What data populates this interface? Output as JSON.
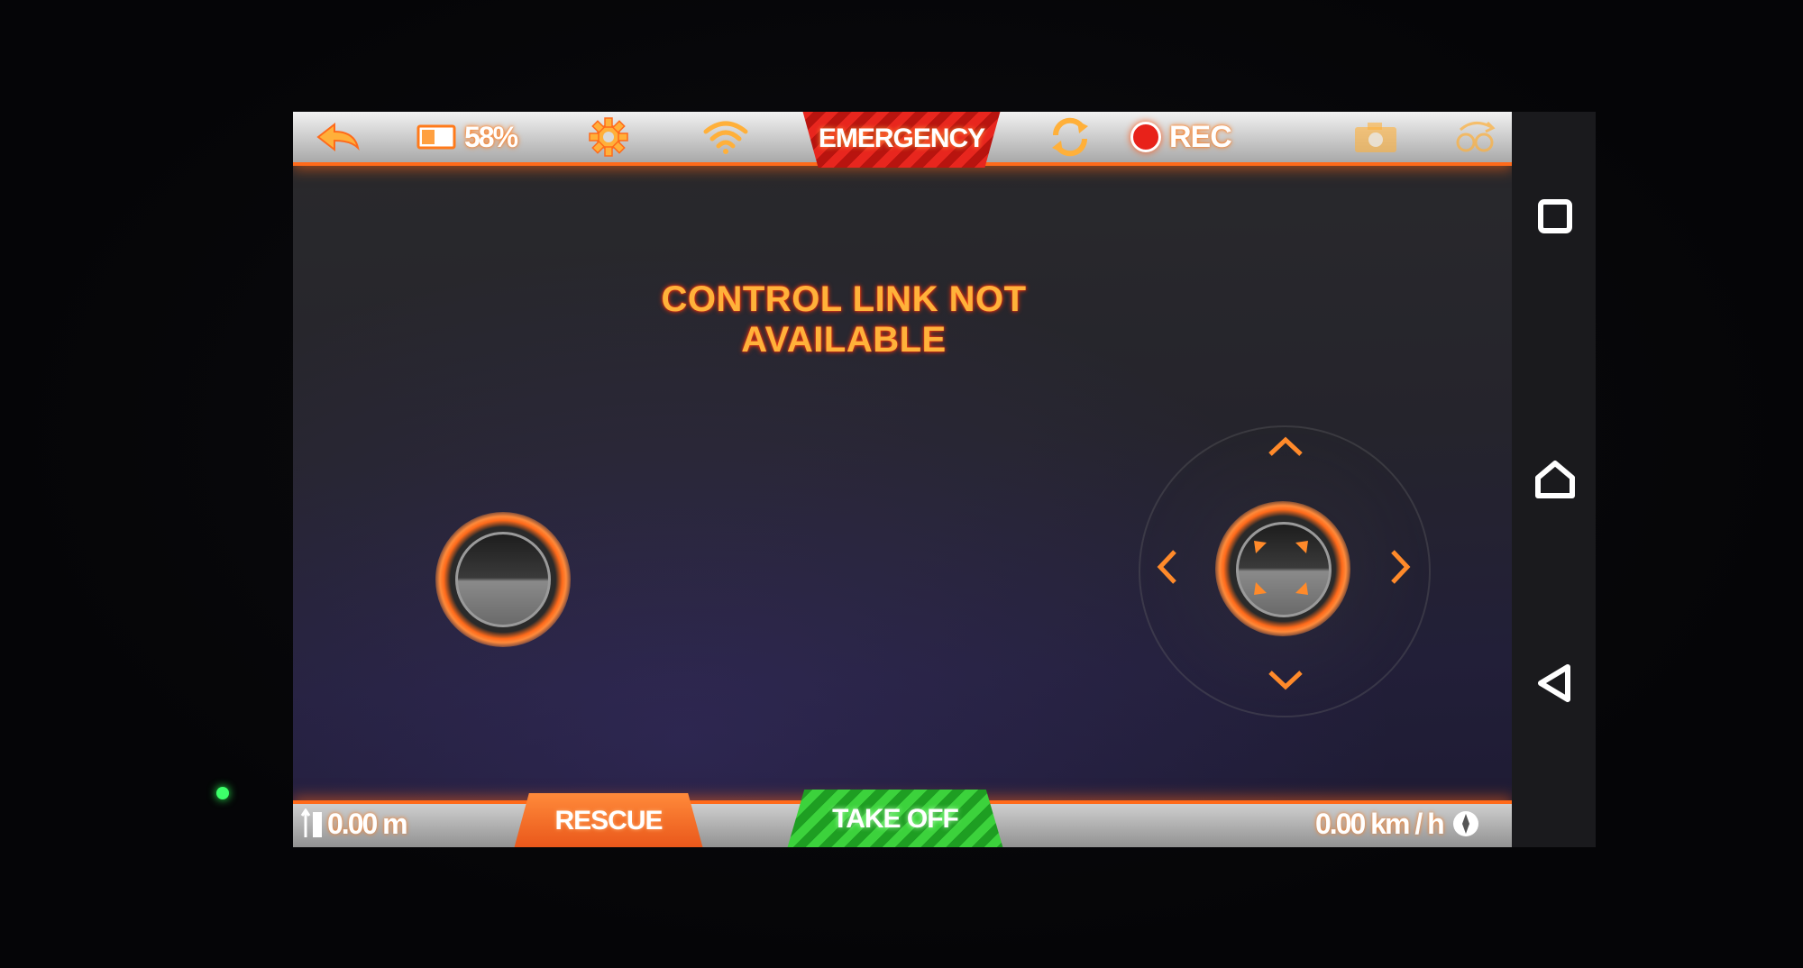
{
  "top_bar": {
    "battery_percent": "58%",
    "emergency_label": "EMERGENCY",
    "rec_label": "REC"
  },
  "main": {
    "warning_text": "CONTROL LINK NOT AVAILABLE"
  },
  "bottom_bar": {
    "altitude": "0.00 m",
    "rescue_label": "RESCUE",
    "takeoff_label": "TAKE OFF",
    "speed": "0.00 km / h"
  },
  "colors": {
    "accent": "#ff6a1a",
    "emergency": "#e8261e",
    "takeoff": "#3cd23c",
    "warning_text": "#ffb23a"
  },
  "icons": [
    "back-arrow-icon",
    "battery-icon",
    "gear-icon",
    "wifi-icon",
    "rotate-icon",
    "record-dot-icon",
    "camera-icon",
    "gesture-icon",
    "compass-icon",
    "altitude-icon",
    "recents-icon",
    "home-icon",
    "back-triangle-icon"
  ]
}
